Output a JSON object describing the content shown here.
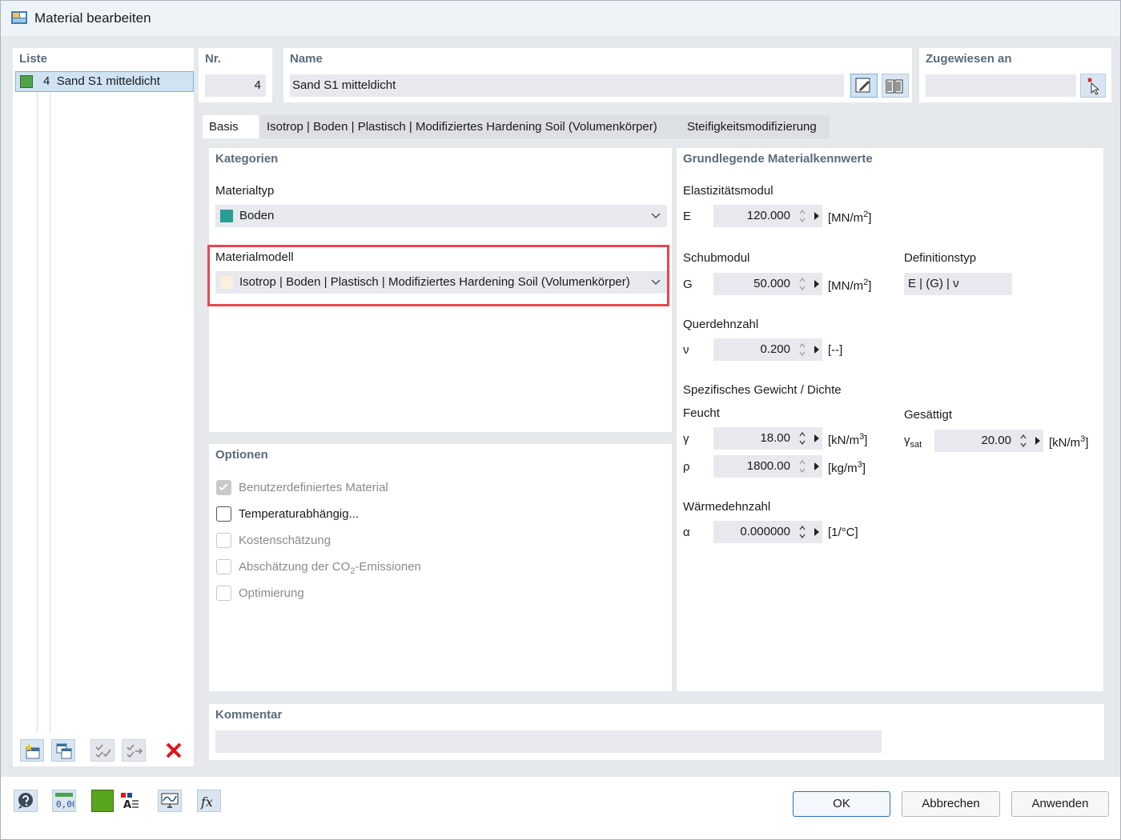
{
  "window": {
    "title": "Material bearbeiten"
  },
  "list": {
    "header": "Liste",
    "items": [
      {
        "number": "4",
        "label": "Sand S1 mitteldicht",
        "color": "#4fa34a"
      }
    ]
  },
  "nr": {
    "header": "Nr.",
    "value": "4"
  },
  "name": {
    "header": "Name",
    "value": "Sand S1 mitteldicht"
  },
  "assigned": {
    "header": "Zugewiesen an",
    "value": ""
  },
  "tabs": [
    {
      "label": "Basis",
      "active": true
    },
    {
      "label": "Isotrop | Boden | Plastisch | Modifiziertes Hardening Soil (Volumenkörper)",
      "active": false
    },
    {
      "label": "Steifigkeitsmodifizierung",
      "active": false
    }
  ],
  "categories": {
    "header": "Kategorien",
    "material_type_label": "Materialtyp",
    "material_type_value": "Boden",
    "material_type_color": "#2a9d94",
    "material_model_label": "Materialmodell",
    "material_model_value": "Isotrop | Boden | Plastisch | Modifiziertes Hardening Soil (Volumenkörper)",
    "material_model_color": "#fbf0dc"
  },
  "options": {
    "header": "Optionen",
    "items": [
      {
        "label": "Benutzerdefiniertes Material",
        "checked": true,
        "enabled": false
      },
      {
        "label": "Temperaturabhängig...",
        "checked": false,
        "enabled": true
      },
      {
        "label": "Kostenschätzung",
        "checked": false,
        "enabled": false
      },
      {
        "label": "Abschätzung der CO",
        "sub": "2",
        "suffix": "-Emissionen",
        "checked": false,
        "enabled": false
      },
      {
        "label": "Optimierung",
        "checked": false,
        "enabled": false
      }
    ]
  },
  "basic_props": {
    "header": "Grundlegende Materialkennwerte",
    "elastic": {
      "label": "Elastizitätsmodul",
      "symbol": "E",
      "value": "120.000",
      "unit": "[MN/m",
      "unit_sup": "2",
      "unit_end": "]"
    },
    "shear": {
      "label": "Schubmodul",
      "symbol": "G",
      "value": "50.000",
      "unit": "[MN/m",
      "unit_sup": "2",
      "unit_end": "]"
    },
    "definition": {
      "label": "Definitionstyp",
      "value": "E | (G) | ν"
    },
    "poisson": {
      "label": "Querdehnzahl",
      "symbol": "ν",
      "value": "0.200",
      "unit": "[--]"
    },
    "weight": {
      "label": "Spezifisches Gewicht / Dichte",
      "moist_label": "Feucht",
      "saturated_label": "Gesättigt",
      "gamma": {
        "symbol": "γ",
        "value": "18.00",
        "unit": "[kN/m",
        "unit_sup": "3",
        "unit_end": "]"
      },
      "rho": {
        "symbol": "ρ",
        "value": "1800.00",
        "unit": "[kg/m",
        "unit_sup": "3",
        "unit_end": "]"
      },
      "gamma_sat": {
        "symbol": "γ",
        "symbol_sub": "sat",
        "value": "20.00",
        "unit": "[kN/m",
        "unit_sup": "3",
        "unit_end": "]"
      }
    },
    "thermal": {
      "label": "Wärmedehnzahl",
      "symbol": "α",
      "value": "0.000000",
      "unit": "[1/°C]"
    }
  },
  "comment": {
    "header": "Kommentar",
    "value": ""
  },
  "buttons": {
    "ok": "OK",
    "cancel": "Abbrechen",
    "apply": "Anwenden"
  },
  "icons": {
    "title": "material-app-icon",
    "bottom": [
      "help-icon",
      "units-icon",
      "color-icon",
      "text-style-icon",
      "display-icon",
      "formula-icon"
    ],
    "list_toolbar": [
      "new-material-icon",
      "copy-material-icon",
      "check-icon",
      "renumber-icon",
      "delete-icon"
    ]
  },
  "bottom_toolbar": {
    "units_label": "0,00",
    "formula_label": "fx"
  }
}
